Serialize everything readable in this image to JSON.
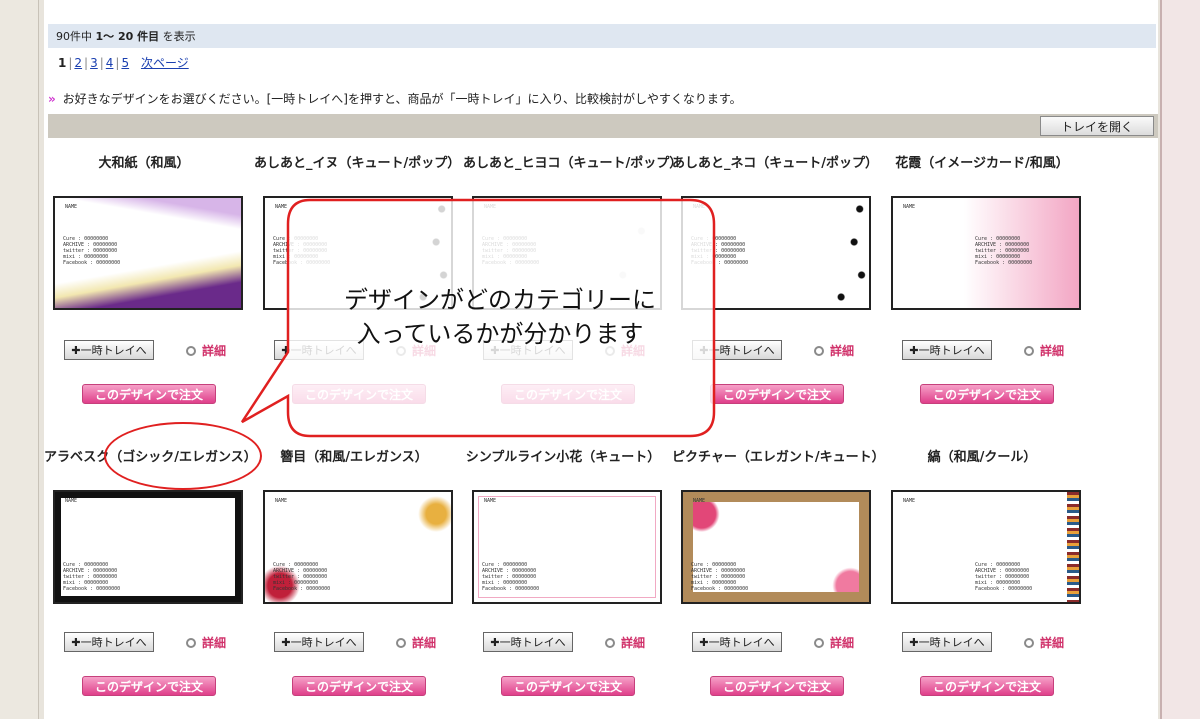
{
  "header": {
    "count_text": "90件中",
    "range_text": "1～ 20 件目",
    "suffix_text": "を表示"
  },
  "pager": {
    "current": "1",
    "pages": [
      "2",
      "3",
      "4",
      "5"
    ],
    "next": "次ページ"
  },
  "instruction": {
    "arrow": "»",
    "text": "お好きなデザインをお選びください。[一時トレイへ]を押すと、商品が「一時トレイ」に入り、比較検討がしやすくなります。"
  },
  "tray": {
    "open_label": "トレイを開く"
  },
  "common": {
    "trade_label": "✚一時トレイへ",
    "detail_label": "詳細",
    "order_label": "このデザインで注文",
    "thumb_name": "NAME",
    "thumb_lines": [
      "Cure : 00000000",
      "ARCHIVE : 00000000",
      "twitter : 00000000",
      "mixi : 00000000",
      "Facebook : 00000000"
    ]
  },
  "designs": [
    {
      "title": "大和紙（和風）",
      "accent": "#6a2a8a"
    },
    {
      "title": "あしあと_イヌ（キュート/ポップ）",
      "accent": "#111111"
    },
    {
      "title": "あしあと_ヒヨコ（キュート/ポップ）",
      "accent": "#dddddd"
    },
    {
      "title": "あしあと_ネコ（キュート/ポップ）",
      "accent": "#111111"
    },
    {
      "title": "花霞（イメージカード/和風）",
      "accent": "#f3a6c4"
    },
    {
      "title": "アラベスク（ゴシック/エレガンス）",
      "accent": "#111111"
    },
    {
      "title": "簪目（和風/エレガンス）",
      "accent": "#c0203a"
    },
    {
      "title": "シンプルライン小花（キュート）",
      "accent": "#f1a9c3"
    },
    {
      "title": "ピクチャー（エレガント/キュート）",
      "accent": "#e24778"
    },
    {
      "title": "縞（和風/クール）",
      "accent": "#8b2b2b"
    }
  ],
  "callout": {
    "line1": "デザインがどのカテゴリーに",
    "line2": "入っているかが分かります"
  }
}
